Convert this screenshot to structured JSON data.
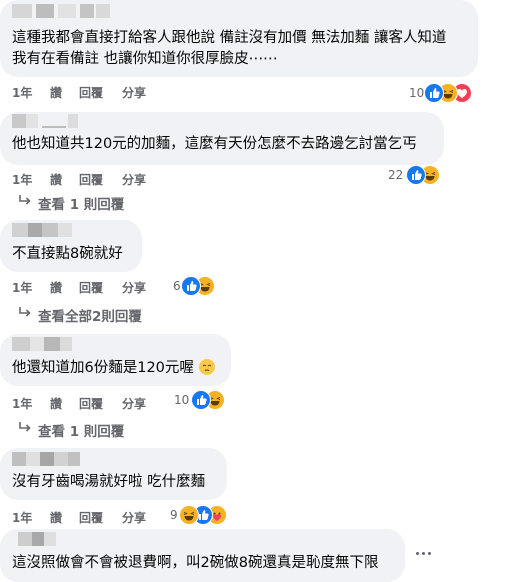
{
  "comments": [
    {
      "text_lines": [
        "這種我都會直接打給客人跟他說 備註沒有加價 無法加麵 讓客人知道",
        "我有在看備註 也讓你知道你很厚臉皮⋯⋯"
      ],
      "actions": {
        "time": "1年",
        "like": "讚",
        "reply": "回覆",
        "share": "分享"
      },
      "reaction_count": "10",
      "reactions": [
        "like-icon",
        "haha-icon",
        "love-icon"
      ]
    },
    {
      "text_lines": [
        "他也知道共120元的加麵，這麼有天份怎麼不去路邊乞討當乞丐"
      ],
      "actions": {
        "time": "1年",
        "like": "讚",
        "reply": "回覆",
        "share": "分享"
      },
      "reaction_count": "22",
      "reactions": [
        "like-icon",
        "haha-icon"
      ],
      "view_replies": "查看 1 則回覆"
    },
    {
      "text_lines": [
        "不直接點8碗就好"
      ],
      "actions": {
        "time": "1年",
        "like": "讚",
        "reply": "回覆",
        "share": "分享"
      },
      "reaction_count": "6",
      "reactions": [
        "like-icon",
        "haha-icon"
      ],
      "view_replies": "查看全部2則回覆"
    },
    {
      "text_lines": [
        "他還知道加6份麵是120元喔"
      ],
      "actions": {
        "time": "1年",
        "like": "讚",
        "reply": "回覆",
        "share": "分享"
      },
      "reaction_count": "10",
      "reactions": [
        "like-icon",
        "haha-icon"
      ],
      "view_replies": "查看 1 則回覆"
    },
    {
      "text_lines": [
        "沒有牙齒喝湯就好啦 吃什麼麵"
      ],
      "actions": {
        "time": "1年",
        "like": "讚",
        "reply": "回覆",
        "share": "分享"
      },
      "reaction_count": "9",
      "reactions": [
        "haha-icon",
        "like-icon",
        "care-icon"
      ]
    },
    {
      "text_lines": [
        "這沒照做會不會被退費啊，叫2碗做8碗還真是恥度無下限"
      ]
    }
  ],
  "colors": {
    "like": "#1877f2",
    "haha": "#f7b125",
    "love": "#f33e58",
    "bubble": "#f0f2f5",
    "meta": "#65676b"
  }
}
